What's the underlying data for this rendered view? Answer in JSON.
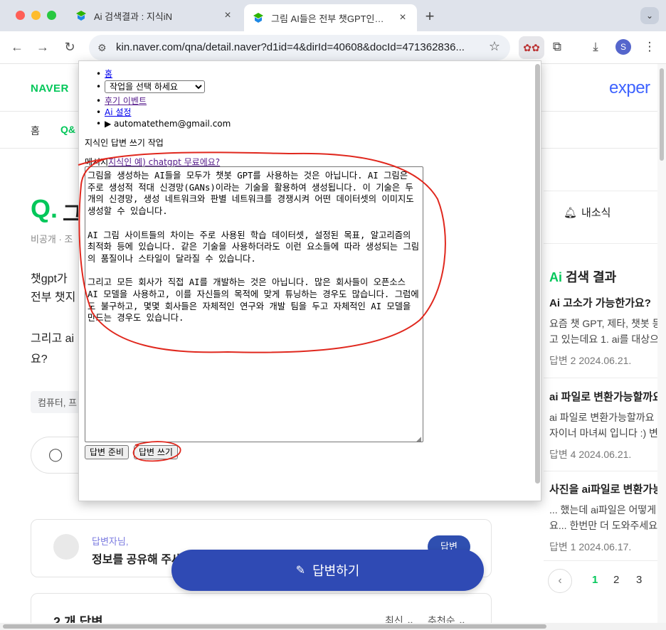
{
  "browser": {
    "tabs": [
      {
        "title": "Ai 검색결과 : 지식iN",
        "active": false
      },
      {
        "title": "그림 AI들은 전부 챗GPT인가요? :",
        "active": true
      }
    ],
    "new_tab": "+",
    "tab_menu": "⌄",
    "url": "kin.naver.com/qna/detail.naver?d1id=4&dirId=40608&docId=471362836...",
    "profile_initial": "S"
  },
  "page": {
    "logo": "NAVER",
    "expert_logo": "exper",
    "nav": {
      "home": "홈",
      "qna": "Q&"
    },
    "question": {
      "mark": "Q.",
      "title_fragment": "그",
      "meta": "비공개 · 조",
      "body_line1": "챗gpt가",
      "body_line2": "전부 챗지",
      "body_line3": "그리고 ai",
      "body_line4": "요?",
      "tag": "컴퓨터, 프"
    },
    "answer_prompt": {
      "sub": "답변자님,",
      "main": "정보를 공유해 주세",
      "button": "답변"
    },
    "answers_header": {
      "count": "2 개 답변",
      "sort_latest": "최신 ⌄",
      "sort_recommend": "추천순 ⌄"
    },
    "fab_label": "답변하기"
  },
  "right_panel": {
    "notice": "내소식",
    "ai_head_accent": "Ai",
    "ai_head_rest": " 검색 결과",
    "items": [
      {
        "title": "Ai 고소가 가능한가요?",
        "snippet1": "요즘 챗 GPT, 제타, 챗봇 등",
        "snippet2": "고 있는데요 1. ai를 대상으",
        "meta": "답변 2  2024.06.21."
      },
      {
        "title": "ai 파일로 변환가능할까요",
        "snippet1": "ai 파일로 변환가능할까요 디",
        "snippet2": "자이너 마녀씨 입니다 :) 변",
        "meta": "답변 4  2024.06.21."
      },
      {
        "title": "사진을 ai파일로 변환가능",
        "snippet1": "... 했는데 ai파일은 어떻게",
        "snippet2": "요... 한번만 더 도와주세요",
        "meta": "답변 1  2024.06.17."
      }
    ],
    "pager": {
      "prev": "‹",
      "pages": [
        "1",
        "2",
        "3"
      ],
      "current": "1"
    }
  },
  "popup": {
    "menu": {
      "home": "홈",
      "select_selected": "작업을 선택 하세요",
      "event": "후기 이벤트",
      "ai_settings": "Ai 설정",
      "account": "▶ automatethem@gmail.com"
    },
    "task_label": "지식인 답변 쓰기 작업",
    "message_prefix": "메시지",
    "message_link": "지식인 예) chatgpt 무료에요?",
    "answer_text": "그림을 생성하는 AI들을 모두가 챗봇 GPT를 사용하는 것은 아닙니다. AI 그림은 주로 생성적 적대 신경망(GANs)이라는 기술을 활용하여 생성됩니다. 이 기술은 두 개의 신경망, 생성 네트워크와 판별 네트워크를 경쟁시켜 어떤 데이터셋의 이미지도 생성할 수 있습니다.\n\nAI 그림 사이트들의 차이는 주로 사용된 학습 데이터셋, 설정된 목표, 알고리즘의 최적화 등에 있습니다. 같은 기술을 사용하더라도 이런 요소들에 따라 생성되는 그림의 품질이나 스타일이 달라질 수 있습니다.\n\n그리고 모든 회사가 직접 AI를 개발하는 것은 아닙니다. 많은 회사들이 오픈소스 AI 모델을 사용하고, 이를 자신들의 목적에 맞게 튜닝하는 경우도 많습니다. 그럼에도 불구하고, 몇몇 회사들은 자체적인 연구와 개발 팀을 두고 자체적인 AI 모델을 만드는 경우도 있습니다.",
    "prepare_button": "답변 준비",
    "write_button": "답변 쓰기"
  },
  "colors": {
    "naver_green": "#03c75a",
    "fab_blue": "#2f4ab4",
    "annotation_red": "#e0281e",
    "link_blue": "#0000ee"
  }
}
